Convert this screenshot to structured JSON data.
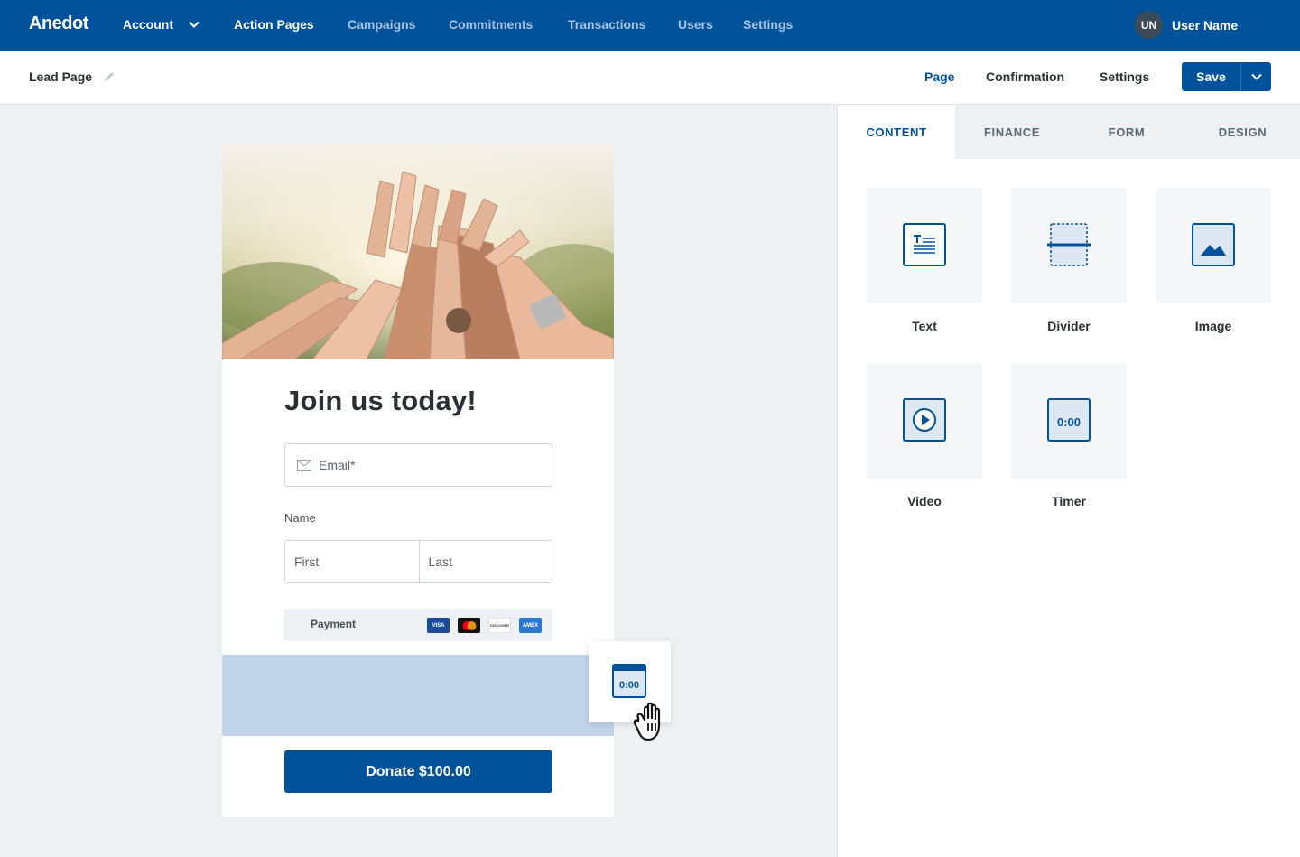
{
  "nav": {
    "brand": "Anedot",
    "items": [
      {
        "label": "Account"
      },
      {
        "label": "Action Pages"
      },
      {
        "label": "Campaigns"
      },
      {
        "label": "Commitments"
      },
      {
        "label": "Transactions"
      },
      {
        "label": "Users"
      },
      {
        "label": "Settings"
      }
    ],
    "user": {
      "initials": "UN",
      "name": "User Name"
    }
  },
  "subheader": {
    "page_name": "Lead Page",
    "tabs": [
      {
        "label": "Page"
      },
      {
        "label": "Confirmation"
      },
      {
        "label": "Settings"
      }
    ],
    "save_label": "Save"
  },
  "form": {
    "title": "Join us today!",
    "email_placeholder": "Email*",
    "name_label": "Name",
    "first_placeholder": "First",
    "last_placeholder": "Last",
    "payment_label": "Payment",
    "donate_label": "Donate $100.00",
    "cards": [
      "VISA",
      "mastercard",
      "DISCOVER",
      "AMEX"
    ]
  },
  "drag": {
    "timer_text": "0:00"
  },
  "panel": {
    "tabs": [
      {
        "label": "CONTENT"
      },
      {
        "label": "FINANCE"
      },
      {
        "label": "FORM"
      },
      {
        "label": "DESIGN"
      }
    ],
    "blocks": [
      {
        "label": "Text",
        "icon": "text-icon"
      },
      {
        "label": "Divider",
        "icon": "divider-icon"
      },
      {
        "label": "Image",
        "icon": "image-icon"
      },
      {
        "label": "Video",
        "icon": "video-icon"
      },
      {
        "label": "Timer",
        "icon": "timer-icon"
      }
    ],
    "timer_text": "0:00"
  },
  "colors": {
    "brand": "#00529b",
    "dropzone": "#c2d4ea",
    "panel_bg": "#eef1f3"
  }
}
